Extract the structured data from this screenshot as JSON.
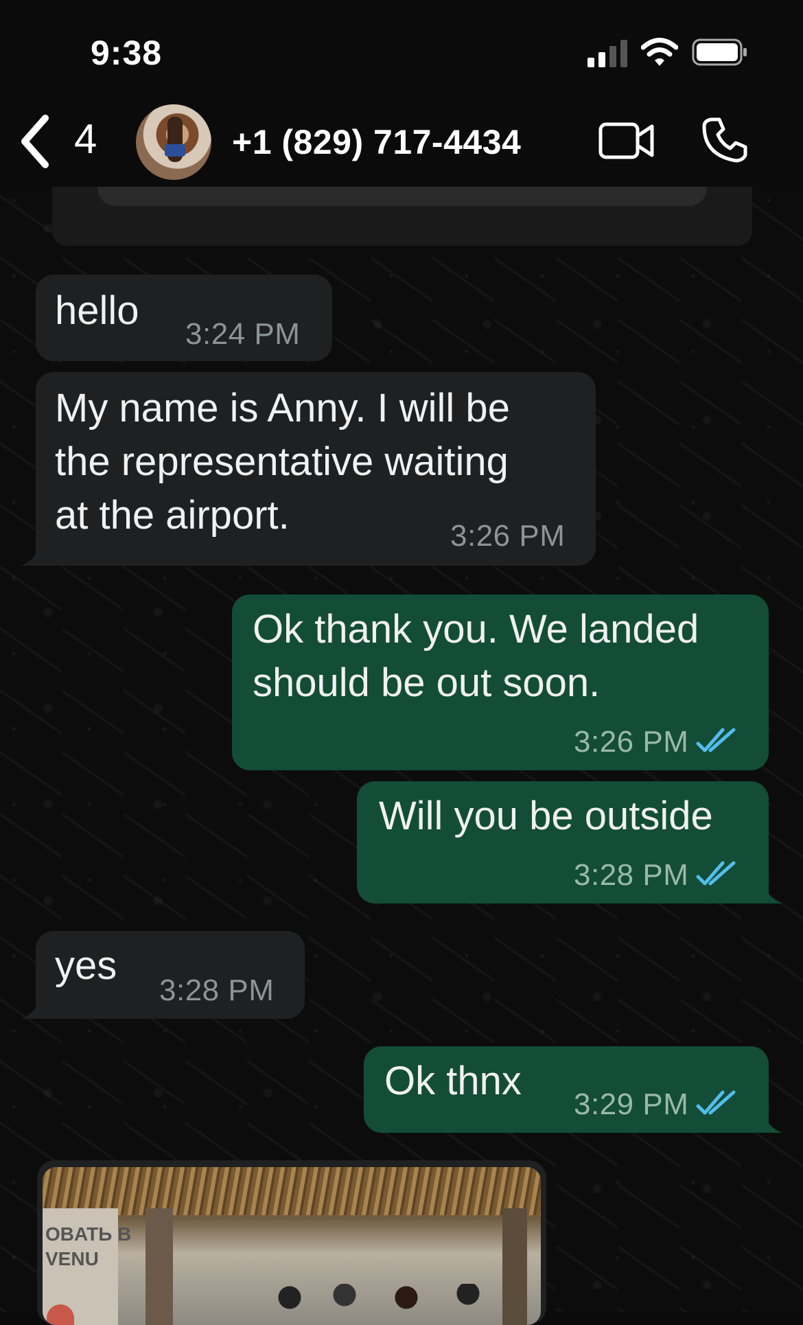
{
  "status_bar": {
    "time": "9:38"
  },
  "header": {
    "back_count": "4",
    "contact_name": "+1 (829) 717-4434"
  },
  "messages": [
    {
      "direction": "in",
      "text": "hello",
      "time": "3:24 PM"
    },
    {
      "direction": "in",
      "text": "My name is Anny. I will be\nthe representative waiting\nat the airport.",
      "time": "3:26 PM"
    },
    {
      "direction": "out",
      "text": "Ok thank you. We landed\nshould be out soon.",
      "time": "3:26 PM",
      "status": "read"
    },
    {
      "direction": "out",
      "text": "Will you be outside",
      "time": "3:28 PM",
      "status": "read"
    },
    {
      "direction": "in",
      "text": "yes",
      "time": "3:28 PM"
    },
    {
      "direction": "out",
      "text": "Ok thnx",
      "time": "3:29 PM",
      "status": "read"
    }
  ],
  "photo_message": {
    "direction": "in",
    "sign_text": "OBATЬ B\nVENU"
  },
  "colors": {
    "incoming_bubble": "#1f2021",
    "outgoing_bubble": "#134d37",
    "read_ticks": "#53bdeb",
    "background": "#0b0b0b"
  },
  "icons": [
    "back-chevron-icon",
    "video-call-icon",
    "phone-call-icon",
    "signal-icon",
    "wifi-icon",
    "battery-icon",
    "double-check-icon"
  ]
}
